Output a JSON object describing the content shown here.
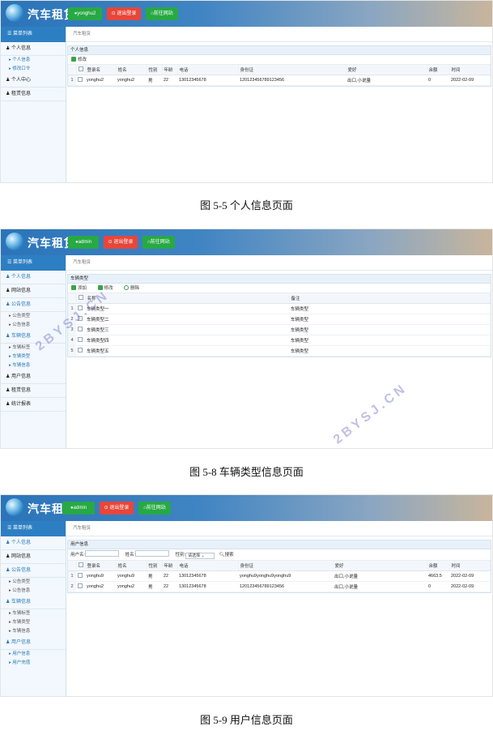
{
  "app": {
    "title": "汽车租赁",
    "menu_header": "菜单列表",
    "breadcrumb": "汽车租赁",
    "logout": "退出登录",
    "front_link": "前往网站"
  },
  "shot1": {
    "user_button": "yonghu2",
    "sidebar": [
      {
        "label": "个人信息",
        "type": "group"
      },
      {
        "label": "个人信息",
        "type": "sub",
        "active": true
      },
      {
        "label": "修改口令",
        "type": "sub",
        "active": true
      },
      {
        "label": "个人中心",
        "type": "group"
      },
      {
        "label": "租赁信息",
        "type": "group"
      }
    ],
    "panel_title": "个人信息",
    "toolbar": [
      "修改"
    ],
    "columns": [
      "登录名",
      "姓名",
      "性别",
      "年龄",
      "电话",
      "身份证",
      "爱好",
      "余额",
      "时间"
    ],
    "rows": [
      [
        "1",
        "yonghu2",
        "yonghu2",
        "男",
        "22",
        "13012345678",
        "120123456789123456",
        "出口,小说量",
        "0",
        "2022-02-09"
      ]
    ],
    "caption": "图 5-5 个人信息页面"
  },
  "shot2": {
    "user_button": "admin",
    "sidebar": [
      {
        "label": "个人信息",
        "type": "group",
        "blue": true
      },
      {
        "label": "网站信息",
        "type": "group"
      },
      {
        "label": "公告信息",
        "type": "group",
        "blue": true
      },
      {
        "label": "公告类型",
        "type": "sub"
      },
      {
        "label": "公告信息",
        "type": "sub"
      },
      {
        "label": "车辆信息",
        "type": "group",
        "blue": true
      },
      {
        "label": "车辆标签",
        "type": "sub"
      },
      {
        "label": "车辆类型",
        "type": "sub",
        "active": true
      },
      {
        "label": "车辆信息",
        "type": "sub",
        "active": true
      },
      {
        "label": "用户信息",
        "type": "group"
      },
      {
        "label": "租赁信息",
        "type": "group"
      },
      {
        "label": "统计报表",
        "type": "group"
      }
    ],
    "panel_title": "车辆类型",
    "toolbar": [
      "添加",
      "修改",
      "删除"
    ],
    "columns": [
      "名称",
      "备注"
    ],
    "rows": [
      [
        "1",
        "车辆类型一",
        "车辆类型"
      ],
      [
        "2",
        "车辆类型二",
        "车辆类型"
      ],
      [
        "3",
        "车辆类型三",
        "车辆类型"
      ],
      [
        "4",
        "车辆类型四",
        "车辆类型"
      ],
      [
        "5",
        "车辆类型五",
        "车辆类型"
      ]
    ],
    "watermark1": "2BYSJ.CN",
    "watermark2": "2BYSJ.CN",
    "caption": "图 5-8 车辆类型信息页面"
  },
  "shot3": {
    "user_button": "admin",
    "sidebar": [
      {
        "label": "个人信息",
        "type": "group",
        "blue": true
      },
      {
        "label": "网站信息",
        "type": "group"
      },
      {
        "label": "公告信息",
        "type": "group",
        "blue": true
      },
      {
        "label": "公告类型",
        "type": "sub"
      },
      {
        "label": "公告信息",
        "type": "sub"
      },
      {
        "label": "车辆信息",
        "type": "group",
        "blue": true
      },
      {
        "label": "车辆标签",
        "type": "sub"
      },
      {
        "label": "车辆类型",
        "type": "sub"
      },
      {
        "label": "车辆信息",
        "type": "sub"
      },
      {
        "label": "用户信息",
        "type": "group",
        "blue": true
      },
      {
        "label": "用户信息",
        "type": "sub",
        "active": true
      },
      {
        "label": "用户充值",
        "type": "sub",
        "active": true
      }
    ],
    "panel_title": "用户信息",
    "search": {
      "username_label": "用户名:",
      "name_label": "姓名:",
      "gender_label": "性别:",
      "gender_value": "请选择",
      "button": "搜索"
    },
    "columns": [
      "登录名",
      "姓名",
      "性别",
      "年龄",
      "电话",
      "身份证",
      "爱好",
      "余额",
      "时间"
    ],
    "rows": [
      [
        "1",
        "yonghu9",
        "yonghu9",
        "男",
        "22",
        "13012345678",
        "yonghu9yonghu9yonghu9",
        "出口,小说量",
        "4663.5",
        "2022-02-09"
      ],
      [
        "2",
        "yonghu2",
        "yonghu2",
        "男",
        "22",
        "13012345678",
        "120123456789123456",
        "出口,小说量",
        "0",
        "2022-02-09"
      ]
    ],
    "caption": "图 5-9 用户信息页面"
  },
  "colors": {
    "header_start": "#2b74b9",
    "header_end": "#c9b59c",
    "green_button": "#27a944",
    "red_button": "#e8463a",
    "menu_header": "#2d7fc3",
    "active": "#2a78b9"
  }
}
